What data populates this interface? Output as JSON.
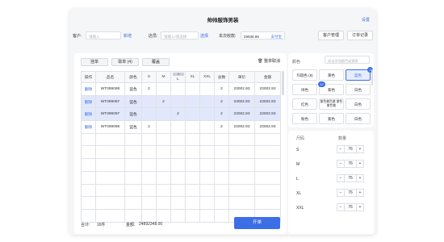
{
  "app": {
    "title": "帅帅服饰男装",
    "settings_label": "设置"
  },
  "header": {
    "customer_label": "客户:",
    "customer_placeholder": "请输入",
    "customer_add": "新增",
    "staff_label": "店员:",
    "staff_placeholder": "请输入/或选择",
    "staff_select": "选择",
    "receivable_label": "本次收款:",
    "receivable_value": "29936.89",
    "payment_method": "支付宝",
    "customer_mgmt": "客户管理",
    "order_records": "订单记录"
  },
  "toolbar": {
    "hold_label": "挂单",
    "retrieve_label": "取单 (4)",
    "overwrite_label": "覆盖",
    "clear_all_label": "整单取消"
  },
  "table": {
    "headers": [
      "操作",
      "品名",
      "颜色",
      "S",
      "M",
      "L",
      "XL",
      "XXL",
      "总数",
      "单价",
      "金额"
    ],
    "l_header_hint": "3",
    "rows": [
      {
        "action": "删除",
        "name": "WT099098",
        "color": "蓝色",
        "S": "2",
        "M": "",
        "L": "",
        "XL": "",
        "XXL": "",
        "total": "2",
        "price": "23002.93",
        "amount": "23002.93"
      },
      {
        "action": "删除",
        "name": "WT099097",
        "color": "蓝色",
        "S": "",
        "M": "2",
        "L": "",
        "XL": "",
        "XXL": "",
        "total": "2",
        "price": "23002.93",
        "amount": "23002.93"
      },
      {
        "action": "删除",
        "name": "WT099097",
        "color": "蓝色",
        "S": "",
        "M": "",
        "L": "2",
        "XL": "",
        "XXL": "",
        "total": "2",
        "price": "23002.93",
        "amount": "23002.93"
      },
      {
        "action": "删除",
        "name": "WT099098",
        "color": "蓝色",
        "S": "2",
        "M": "",
        "L": "",
        "XL": "",
        "XXL": "",
        "total": "2",
        "price": "23002.93",
        "amount": "23002.93"
      }
    ]
  },
  "footer": {
    "count_label": "合计:",
    "count_value": "16件",
    "amount_label": "金额:",
    "amount_value": "24892348.00",
    "submit_label": "开单"
  },
  "colors": {
    "section_label": "颜色",
    "search_placeholder": "双击添加颜色或搜索",
    "chips": [
      "玛瑙色 (8)",
      "黄色",
      "蓝色",
      "绿色",
      "紫色",
      "白色",
      "红色",
      "紫色紫色紫 紫色紫色紫",
      "白色",
      "粉色",
      "紫色",
      "白色"
    ],
    "badge_blue": "2",
    "badge_purple": "12"
  },
  "sizes": {
    "size_header": "尺码",
    "qty_header": "数量",
    "items": [
      {
        "size": "S",
        "qty": "76"
      },
      {
        "size": "M",
        "qty": "76"
      },
      {
        "size": "L",
        "qty": "76"
      },
      {
        "size": "XL",
        "qty": "76"
      },
      {
        "size": "XXL",
        "qty": "76"
      }
    ],
    "minus": "−",
    "plus": "+"
  },
  "theme": {
    "accent": "#3c6fe6",
    "selected_row": "#e2e8fb"
  }
}
